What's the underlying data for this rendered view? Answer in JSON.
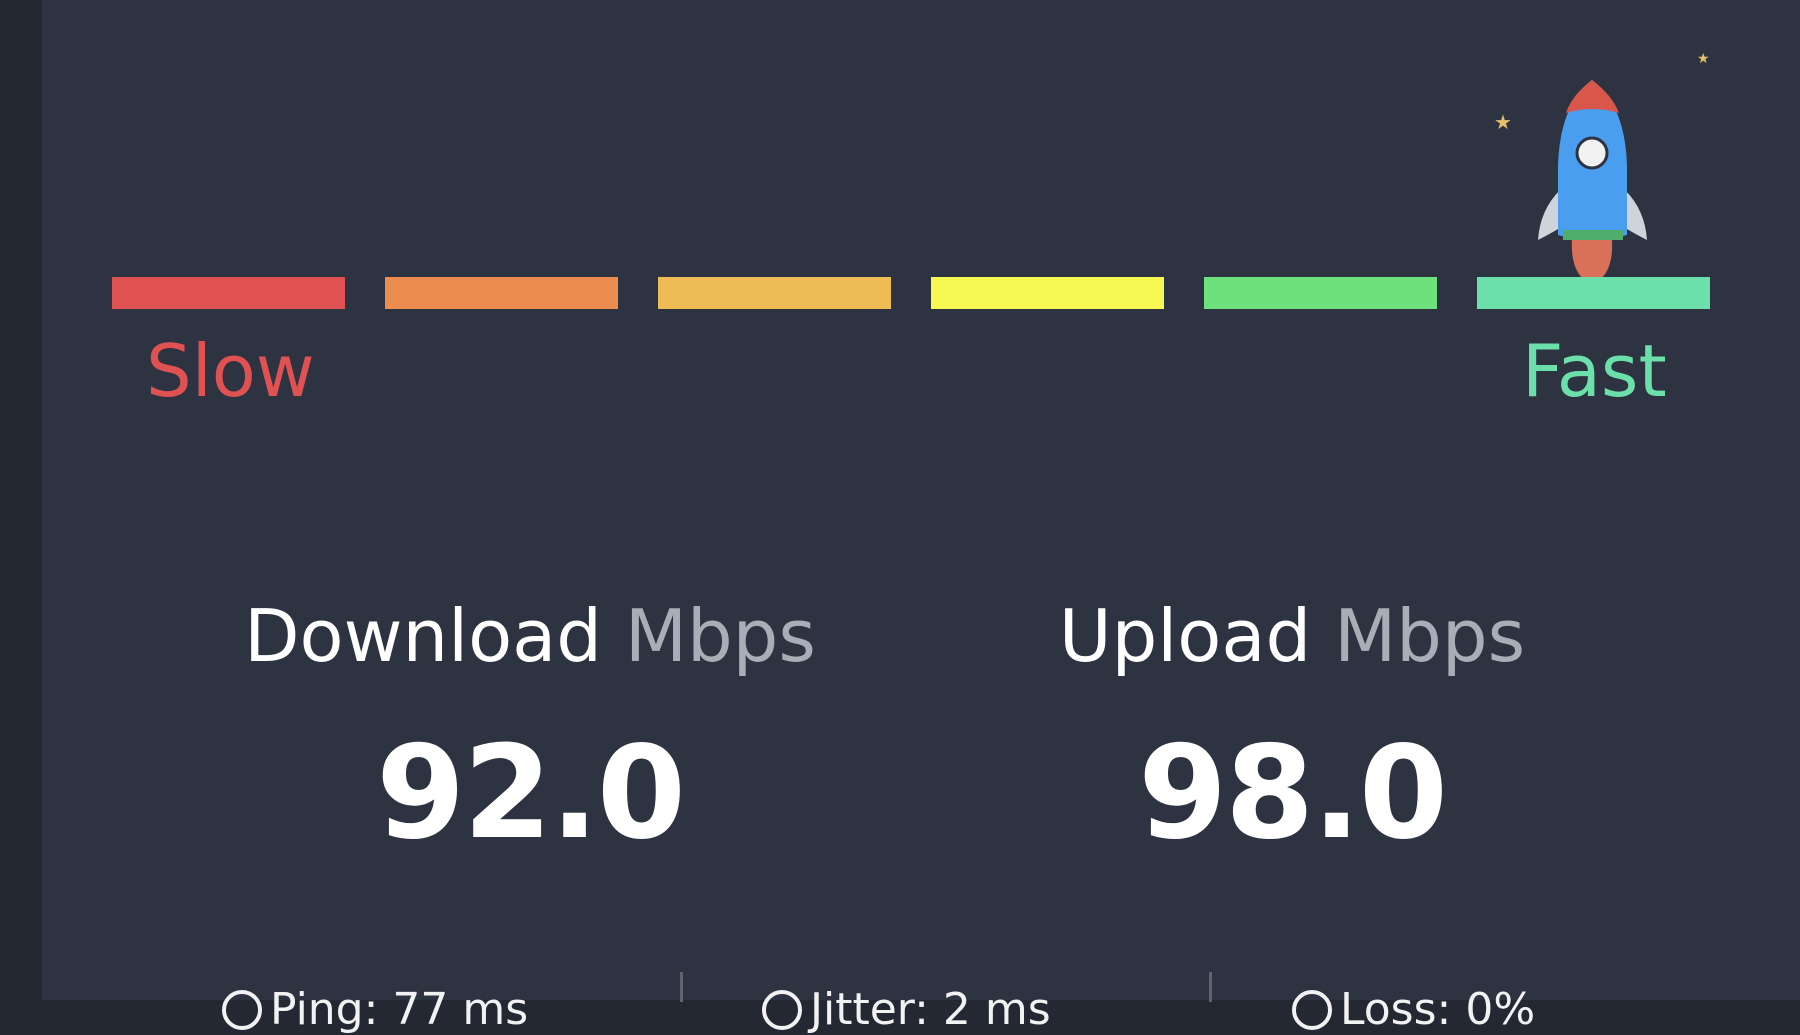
{
  "speed_scale": {
    "segments": [
      {
        "color": "#e05252",
        "start": 0
      },
      {
        "color": "#ec8c4f",
        "start": 1
      },
      {
        "color": "#eebb55",
        "start": 2
      },
      {
        "color": "#f7f752",
        "start": 3
      },
      {
        "color": "#6ee07c",
        "start": 4
      },
      {
        "color": "#6be0aa",
        "start": 5
      }
    ],
    "slow_label": "Slow",
    "fast_label": "Fast",
    "slow_color": "#e05252",
    "fast_color": "#6be0aa",
    "current_level": 6,
    "max_level": 6
  },
  "indicator": {
    "icon": "rocket-icon",
    "star_color": "#e3c06a"
  },
  "download": {
    "label": "Download",
    "unit": "Mbps",
    "value": "92.0"
  },
  "upload": {
    "label": "Upload",
    "unit": "Mbps",
    "value": "98.0"
  },
  "stats": [
    {
      "icon": "ping-icon",
      "text": "Ping: 77 ms"
    },
    {
      "icon": "jitter-icon",
      "text": "Jitter: 2 ms"
    },
    {
      "icon": "loss-icon",
      "text": "Loss: 0%"
    }
  ]
}
